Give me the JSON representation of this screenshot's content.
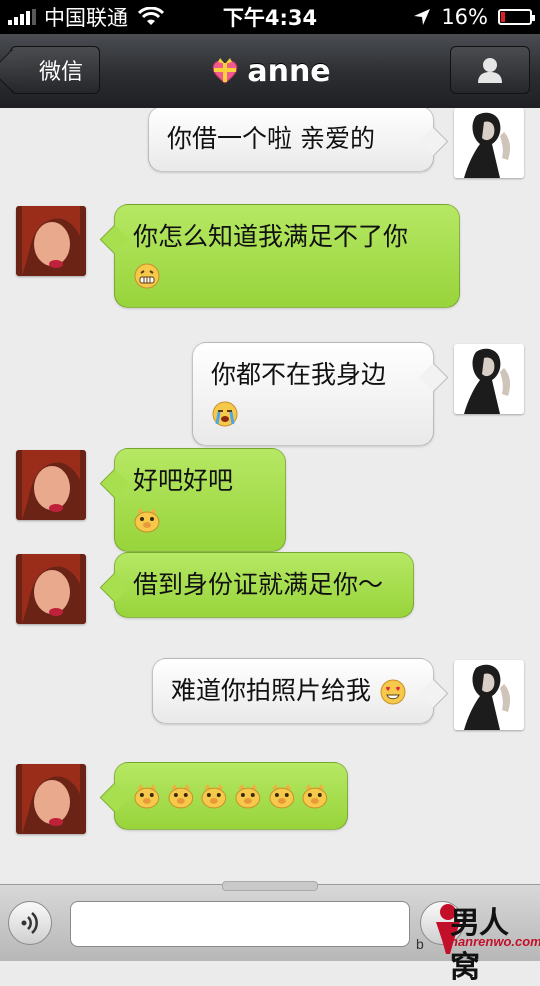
{
  "status_bar": {
    "carrier": "中国联通",
    "time": "下午4:34",
    "battery": "16%",
    "battery_level": 0.16
  },
  "nav": {
    "back_label": "微信",
    "title": "anne"
  },
  "messages": [
    {
      "side": "right",
      "text": "你借一个啦 亲爱的",
      "emojis": []
    },
    {
      "side": "left",
      "text": "你怎么知道我满足不了你",
      "emojis": [
        "grin-emoji"
      ]
    },
    {
      "side": "right",
      "text": "你都不在我身边",
      "emojis": [
        "crying-emoji"
      ]
    },
    {
      "side": "left",
      "text": "好吧好吧",
      "emojis": [
        "pig-face-emoji"
      ]
    },
    {
      "side": "left",
      "text": "借到身份证就满足你～",
      "emojis": []
    },
    {
      "side": "right",
      "text": "难道你拍照片给我",
      "emojis": [
        "heart-eyes-emoji"
      ]
    },
    {
      "side": "left",
      "text": "",
      "emojis": [
        "pig-face-emoji",
        "pig-face-emoji",
        "pig-face-emoji",
        "pig-face-emoji",
        "pig-face-emoji",
        "pig-face-emoji"
      ]
    }
  ],
  "input": {
    "value": ""
  },
  "watermark": {
    "brand": "男人窝",
    "url": "nanrenwo.com",
    "prefix": "b"
  },
  "colors": {
    "bubble_green": "#a8df4f",
    "bubble_white": "#f4f4f4",
    "nav_bar": "#2b2d30"
  }
}
